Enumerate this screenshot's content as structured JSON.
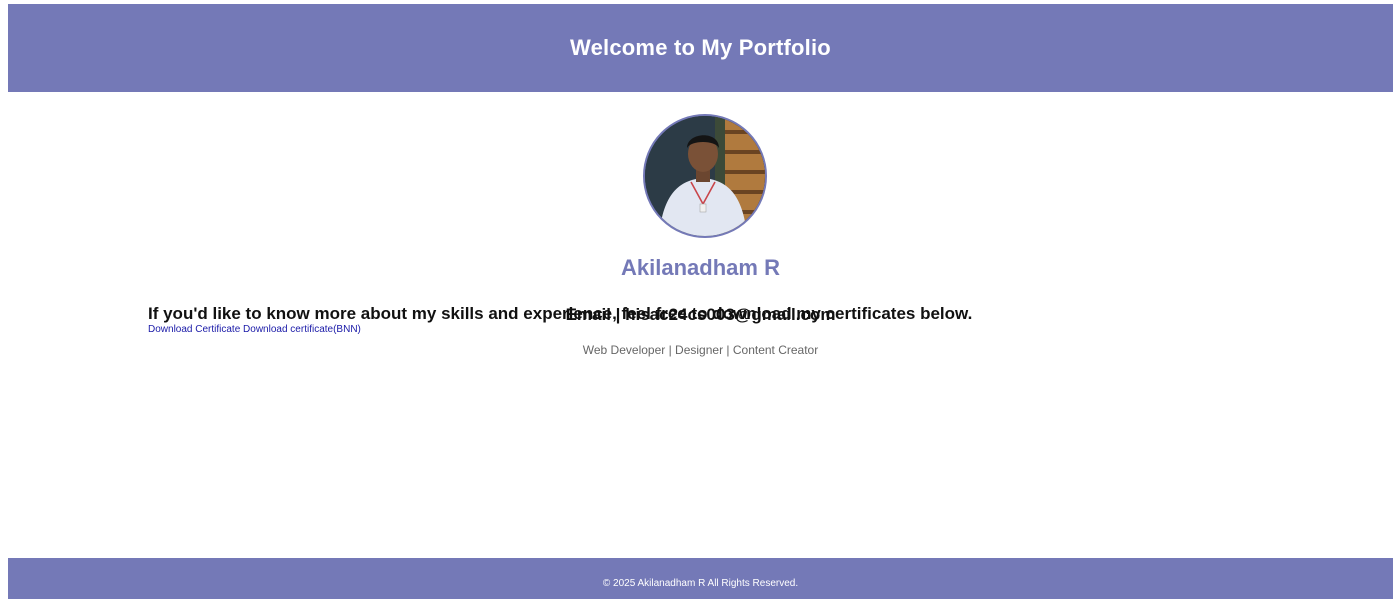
{
  "header": {
    "title": "Welcome to My Portfolio"
  },
  "profile": {
    "photo_icon": "profile-photo",
    "name": "Akilanadham R",
    "email_line": "Email | hisac24cs003@gmail.com",
    "roles": "Web Developer | Designer | Content Creator"
  },
  "main": {
    "intro": "If you'd like to know more about my skills and experience, feel free to download my certificates below.",
    "links": {
      "certificate": "Download Certificate",
      "certificate_bnn": "Download certificate(BNN)"
    }
  },
  "footer": {
    "copyright": "© 2025 Akilanadham R All Rights Reserved."
  },
  "colors": {
    "accent": "#7479b7",
    "link": "#1a1aa8"
  }
}
